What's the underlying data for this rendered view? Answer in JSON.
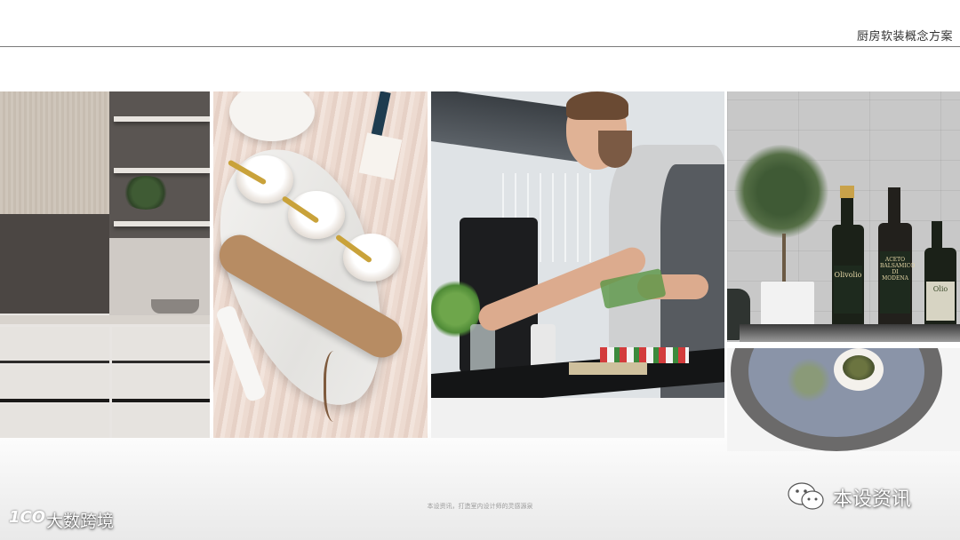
{
  "header": {
    "title": "厨房软装概念方案"
  },
  "gallery": {
    "photos": [
      {
        "subject": "kitchen-cabinet"
      },
      {
        "subject": "marble-board-bowls"
      },
      {
        "subject": "chef-herbs"
      },
      {
        "subject": "olive-oil-bottles"
      },
      {
        "subject": "plate-capers"
      }
    ],
    "bottle_labels": [
      "Olivolio",
      "ACETO BALSAMICO DI MODENA",
      "Olio"
    ]
  },
  "footer": {
    "caption": "本设资讯，打造室内设计师的灵感源泉",
    "wechat_account": "本设资讯",
    "watermark": "大数跨境",
    "watermark_mark": "1CO"
  },
  "colors": {
    "header_text": "#333333",
    "rule": "#7a7a7a",
    "caption_text": "#9a9a9a"
  }
}
